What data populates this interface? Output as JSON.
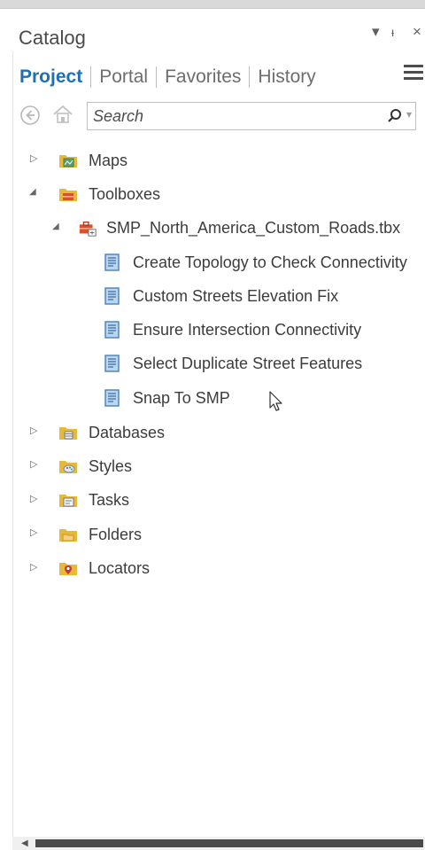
{
  "pane": {
    "title": "Catalog"
  },
  "tabs": [
    {
      "label": "Project",
      "active": true
    },
    {
      "label": "Portal",
      "active": false
    },
    {
      "label": "Favorites",
      "active": false
    },
    {
      "label": "History",
      "active": false
    }
  ],
  "search": {
    "placeholder": "Search"
  },
  "tree": {
    "maps": "Maps",
    "toolboxes": "Toolboxes",
    "toolbox_file": "SMP_North_America_Custom_Roads.tbx",
    "tools": [
      "Create Topology to Check Connectivity",
      "Custom Streets Elevation Fix",
      "Ensure Intersection Connectivity",
      "Select Duplicate Street Features",
      "Snap To SMP"
    ],
    "databases": "Databases",
    "styles": "Styles",
    "tasks": "Tasks",
    "folders": "Folders",
    "locators": "Locators"
  },
  "colors": {
    "accent": "#1f6fb7",
    "folder": "#e8b83a",
    "toolbox": "#d9502b"
  }
}
